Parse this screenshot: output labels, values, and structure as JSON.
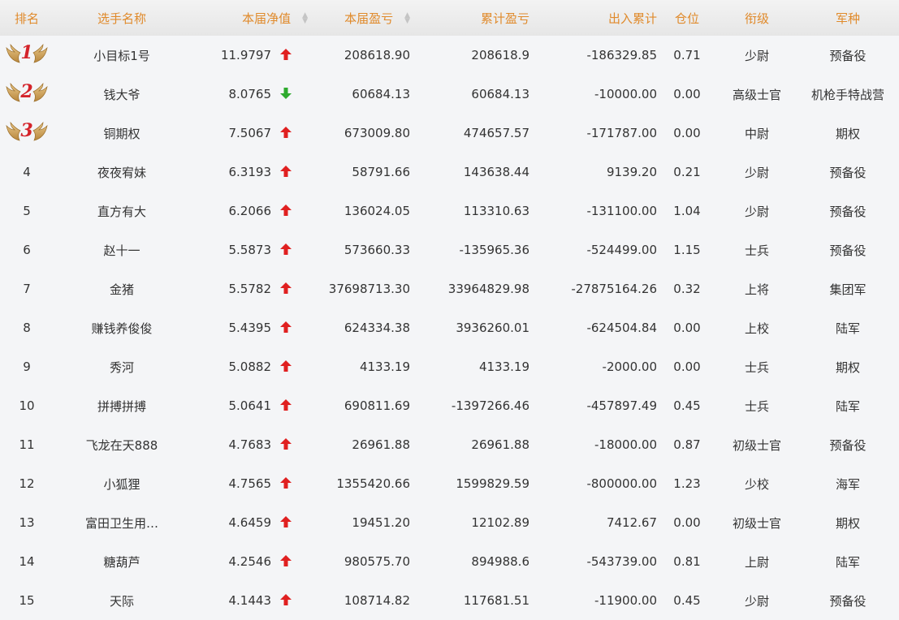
{
  "headers": {
    "rank": "排名",
    "name": "选手名称",
    "nav": "本届净值",
    "pnl": "本届盈亏",
    "cum": "累计盈亏",
    "flow": "出入累计",
    "pos": "仓位",
    "grade": "衔级",
    "arm": "军种"
  },
  "colors": {
    "header_text": "#e08a2b",
    "up_arrow": "#e02020",
    "down_arrow": "#2eaa2e",
    "medal_number": "#d4232a"
  },
  "rows": [
    {
      "rank": "1",
      "name": "小目标1号",
      "nav": "11.9797",
      "trend": "up",
      "pnl": "208618.90",
      "cum": "208618.9",
      "flow": "-186329.85",
      "pos": "0.71",
      "grade": "少尉",
      "arm": "预备役"
    },
    {
      "rank": "2",
      "name": "钱大爷",
      "nav": "8.0765",
      "trend": "down",
      "pnl": "60684.13",
      "cum": "60684.13",
      "flow": "-10000.00",
      "pos": "0.00",
      "grade": "高级士官",
      "arm": "机枪手特战营"
    },
    {
      "rank": "3",
      "name": "铜期权",
      "nav": "7.5067",
      "trend": "up",
      "pnl": "673009.80",
      "cum": "474657.57",
      "flow": "-171787.00",
      "pos": "0.00",
      "grade": "中尉",
      "arm": "期权"
    },
    {
      "rank": "4",
      "name": "夜夜宥妹",
      "nav": "6.3193",
      "trend": "up",
      "pnl": "58791.66",
      "cum": "143638.44",
      "flow": "9139.20",
      "pos": "0.21",
      "grade": "少尉",
      "arm": "预备役"
    },
    {
      "rank": "5",
      "name": "直方有大",
      "nav": "6.2066",
      "trend": "up",
      "pnl": "136024.05",
      "cum": "113310.63",
      "flow": "-131100.00",
      "pos": "1.04",
      "grade": "少尉",
      "arm": "预备役"
    },
    {
      "rank": "6",
      "name": "赵十一",
      "nav": "5.5873",
      "trend": "up",
      "pnl": "573660.33",
      "cum": "-135965.36",
      "flow": "-524499.00",
      "pos": "1.15",
      "grade": "士兵",
      "arm": "预备役"
    },
    {
      "rank": "7",
      "name": "金猪",
      "nav": "5.5782",
      "trend": "up",
      "pnl": "37698713.30",
      "cum": "33964829.98",
      "flow": "-27875164.26",
      "pos": "0.32",
      "grade": "上将",
      "arm": "集团军"
    },
    {
      "rank": "8",
      "name": "赚钱养俊俊",
      "nav": "5.4395",
      "trend": "up",
      "pnl": "624334.38",
      "cum": "3936260.01",
      "flow": "-624504.84",
      "pos": "0.00",
      "grade": "上校",
      "arm": "陆军"
    },
    {
      "rank": "9",
      "name": "秀河",
      "nav": "5.0882",
      "trend": "up",
      "pnl": "4133.19",
      "cum": "4133.19",
      "flow": "-2000.00",
      "pos": "0.00",
      "grade": "士兵",
      "arm": "期权"
    },
    {
      "rank": "10",
      "name": "拼搏拼搏",
      "nav": "5.0641",
      "trend": "up",
      "pnl": "690811.69",
      "cum": "-1397266.46",
      "flow": "-457897.49",
      "pos": "0.45",
      "grade": "士兵",
      "arm": "陆军"
    },
    {
      "rank": "11",
      "name": "飞龙在天888",
      "nav": "4.7683",
      "trend": "up",
      "pnl": "26961.88",
      "cum": "26961.88",
      "flow": "-18000.00",
      "pos": "0.87",
      "grade": "初级士官",
      "arm": "预备役"
    },
    {
      "rank": "12",
      "name": "小狐狸",
      "nav": "4.7565",
      "trend": "up",
      "pnl": "1355420.66",
      "cum": "1599829.59",
      "flow": "-800000.00",
      "pos": "1.23",
      "grade": "少校",
      "arm": "海军"
    },
    {
      "rank": "13",
      "name": "富田卫生用…",
      "nav": "4.6459",
      "trend": "up",
      "pnl": "19451.20",
      "cum": "12102.89",
      "flow": "7412.67",
      "pos": "0.00",
      "grade": "初级士官",
      "arm": "期权"
    },
    {
      "rank": "14",
      "name": "糖葫芦",
      "nav": "4.2546",
      "trend": "up",
      "pnl": "980575.70",
      "cum": "894988.6",
      "flow": "-543739.00",
      "pos": "0.81",
      "grade": "上尉",
      "arm": "陆军"
    },
    {
      "rank": "15",
      "name": "天际",
      "nav": "4.1443",
      "trend": "up",
      "pnl": "108714.82",
      "cum": "117681.51",
      "flow": "-11900.00",
      "pos": "0.45",
      "grade": "少尉",
      "arm": "预备役"
    }
  ]
}
